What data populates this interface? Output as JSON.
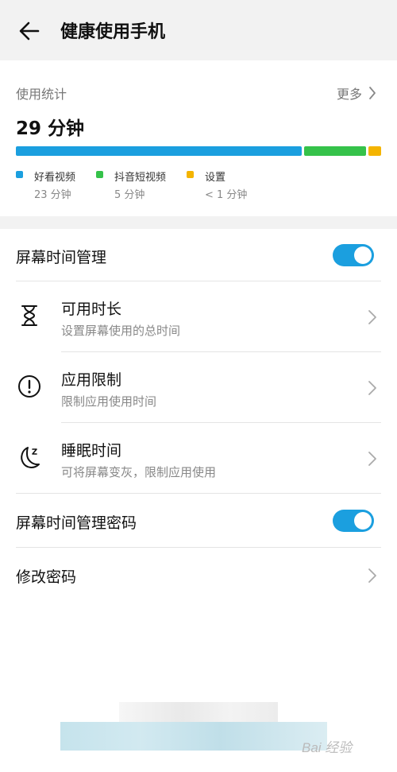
{
  "header": {
    "title": "健康使用手机",
    "back_icon": "arrow-left-icon"
  },
  "stats": {
    "label": "使用统计",
    "more_label": "更多",
    "total": "29 分钟",
    "usage_shares": [
      23,
      5,
      1
    ],
    "apps": [
      {
        "name": "好看视频",
        "duration": "23 分钟",
        "color": "#1b9fdf"
      },
      {
        "name": "抖音短视频",
        "duration": "5 分钟",
        "color": "#35c24a"
      },
      {
        "name": "设置",
        "duration": "< 1 分钟",
        "color": "#f4b400"
      }
    ]
  },
  "list": {
    "screen_time": {
      "label": "屏幕时间管理",
      "enabled": true
    },
    "items": [
      {
        "title": "可用时长",
        "subtitle": "设置屏幕使用的总时间",
        "icon": "hourglass-icon"
      },
      {
        "title": "应用限制",
        "subtitle": "限制应用使用时间",
        "icon": "alert-circle-icon"
      },
      {
        "title": "睡眠时间",
        "subtitle": "可将屏幕变灰，限制应用使用",
        "icon": "moon-sleep-icon"
      }
    ],
    "password": {
      "label": "屏幕时间管理密码",
      "enabled": true
    },
    "change_password": {
      "label": "修改密码"
    }
  },
  "accent_color": "#1b9fdf",
  "watermark": "Bai 经验"
}
